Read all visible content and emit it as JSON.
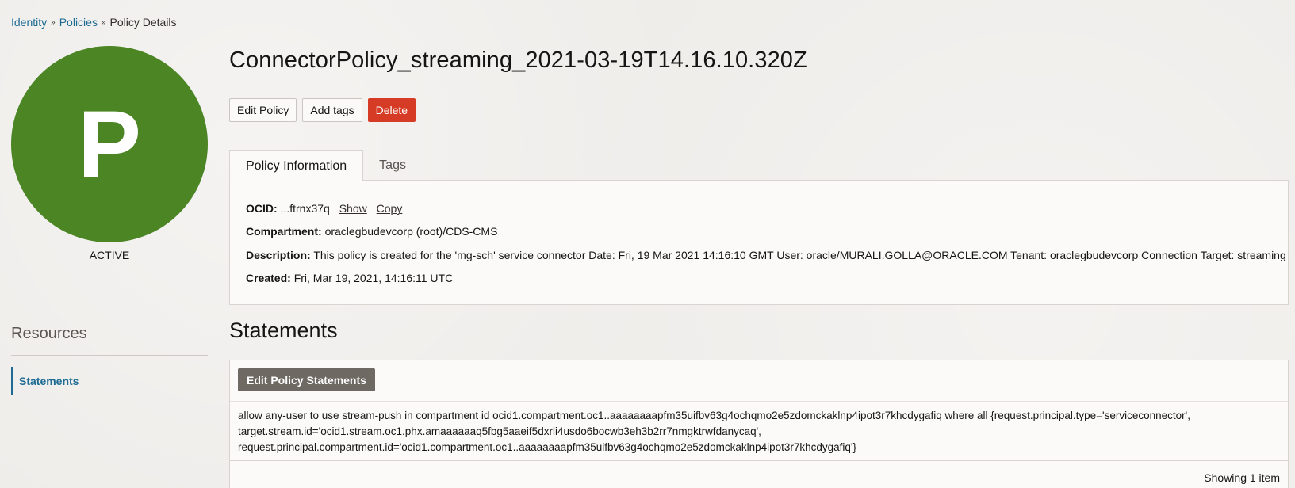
{
  "breadcrumb": {
    "items": [
      "Identity",
      "Policies"
    ],
    "current": "Policy Details"
  },
  "avatar": {
    "letter": "P",
    "color": "#4b8524"
  },
  "status": "ACTIVE",
  "resources": {
    "title": "Resources",
    "items": [
      "Statements"
    ]
  },
  "page": {
    "title": "ConnectorPolicy_streaming_2021-03-19T14.16.10.320Z"
  },
  "actions": {
    "edit": "Edit Policy",
    "add_tags": "Add tags",
    "delete": "Delete"
  },
  "tabs": [
    "Policy Information",
    "Tags"
  ],
  "info": {
    "ocid_label": "OCID:",
    "ocid_value": "...ftrnx37q",
    "show": "Show",
    "copy": "Copy",
    "compartment_label": "Compartment:",
    "compartment_value": "oraclegbudevcorp (root)/CDS-CMS",
    "description_label": "Description:",
    "description_value": "This policy is created for the 'mg-sch' service connector Date: Fri, 19 Mar 2021 14:16:10 GMT User: oracle/MURALI.GOLLA@ORACLE.COM Tenant: oraclegbudevcorp Connection Target: streaming",
    "created_label": "Created:",
    "created_value": "Fri, Mar 19, 2021, 14:16:11 UTC"
  },
  "statements": {
    "title": "Statements",
    "edit_button": "Edit Policy Statements",
    "lines": [
      "allow any-user to use stream-push in compartment id ocid1.compartment.oc1..aaaaaaaapfm35uifbv63g4ochqmo2e5zdomckaklnp4ipot3r7khcdygafiq where all {request.principal.type='serviceconnector',",
      "target.stream.id='ocid1.stream.oc1.phx.amaaaaaaq5fbg5aaeif5dxrli4usdo6bocwb3eh3b2rr7nmgktrwfdanycaq',",
      "request.principal.compartment.id='ocid1.compartment.oc1..aaaaaaaapfm35uifbv63g4ochqmo2e5zdomckaklnp4ipot3r7khcdygafiq'}"
    ],
    "showing": "Showing 1 item"
  }
}
